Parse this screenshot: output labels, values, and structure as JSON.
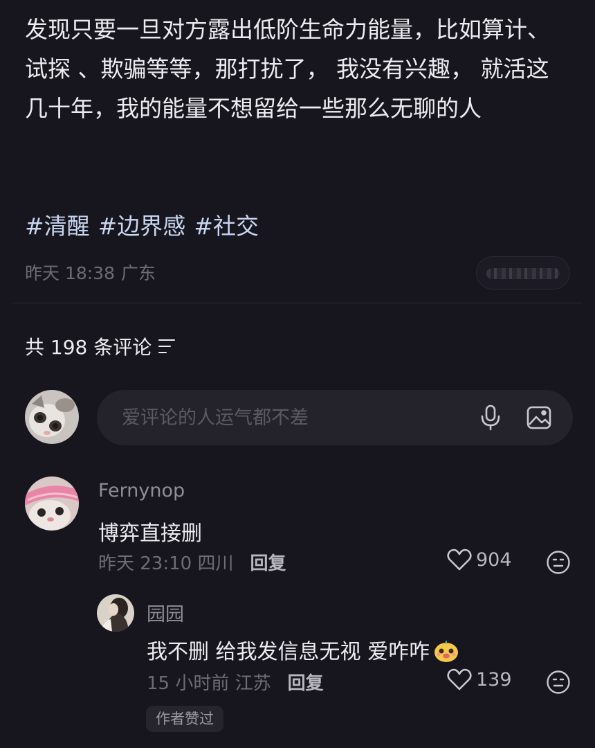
{
  "post": {
    "body": "发现只要一旦对方露出低阶生命力能量，比如算计、 试探 、欺骗等等，那打扰了， 我没有兴趣， 就活这几十年，我的能量不想留给一些那么无聊的人",
    "tags": [
      "#清醒",
      "#边界感",
      "#社交"
    ],
    "time": "昨天 18:38",
    "location": "广东"
  },
  "comments_header": {
    "label": "共 198 条评论",
    "sort_icon": "sort-lines-icon"
  },
  "composer": {
    "placeholder": "爱评论的人运气都不差",
    "icons": [
      "mic-icon",
      "image-icon"
    ]
  },
  "comments": [
    {
      "username": "Fernynop",
      "text": "博弈直接删",
      "time": "昨天 23:10",
      "location": "四川",
      "reply_label": "回复",
      "likes": "904",
      "avatar_icon": "kitten-avatar"
    }
  ],
  "replies": [
    {
      "username": "园园",
      "text": "我不删 给我发信息无视 爱咋咋",
      "time": "15 小时前",
      "location": "江苏",
      "reply_label": "回复",
      "likes": "139",
      "badge": "作者赞过",
      "avatar_icon": "person-avatar"
    }
  ],
  "colors": {
    "background": "#17161e",
    "tag": "#c9d6ef",
    "muted": "#6e6d76",
    "composer_bg": "#24232c"
  }
}
